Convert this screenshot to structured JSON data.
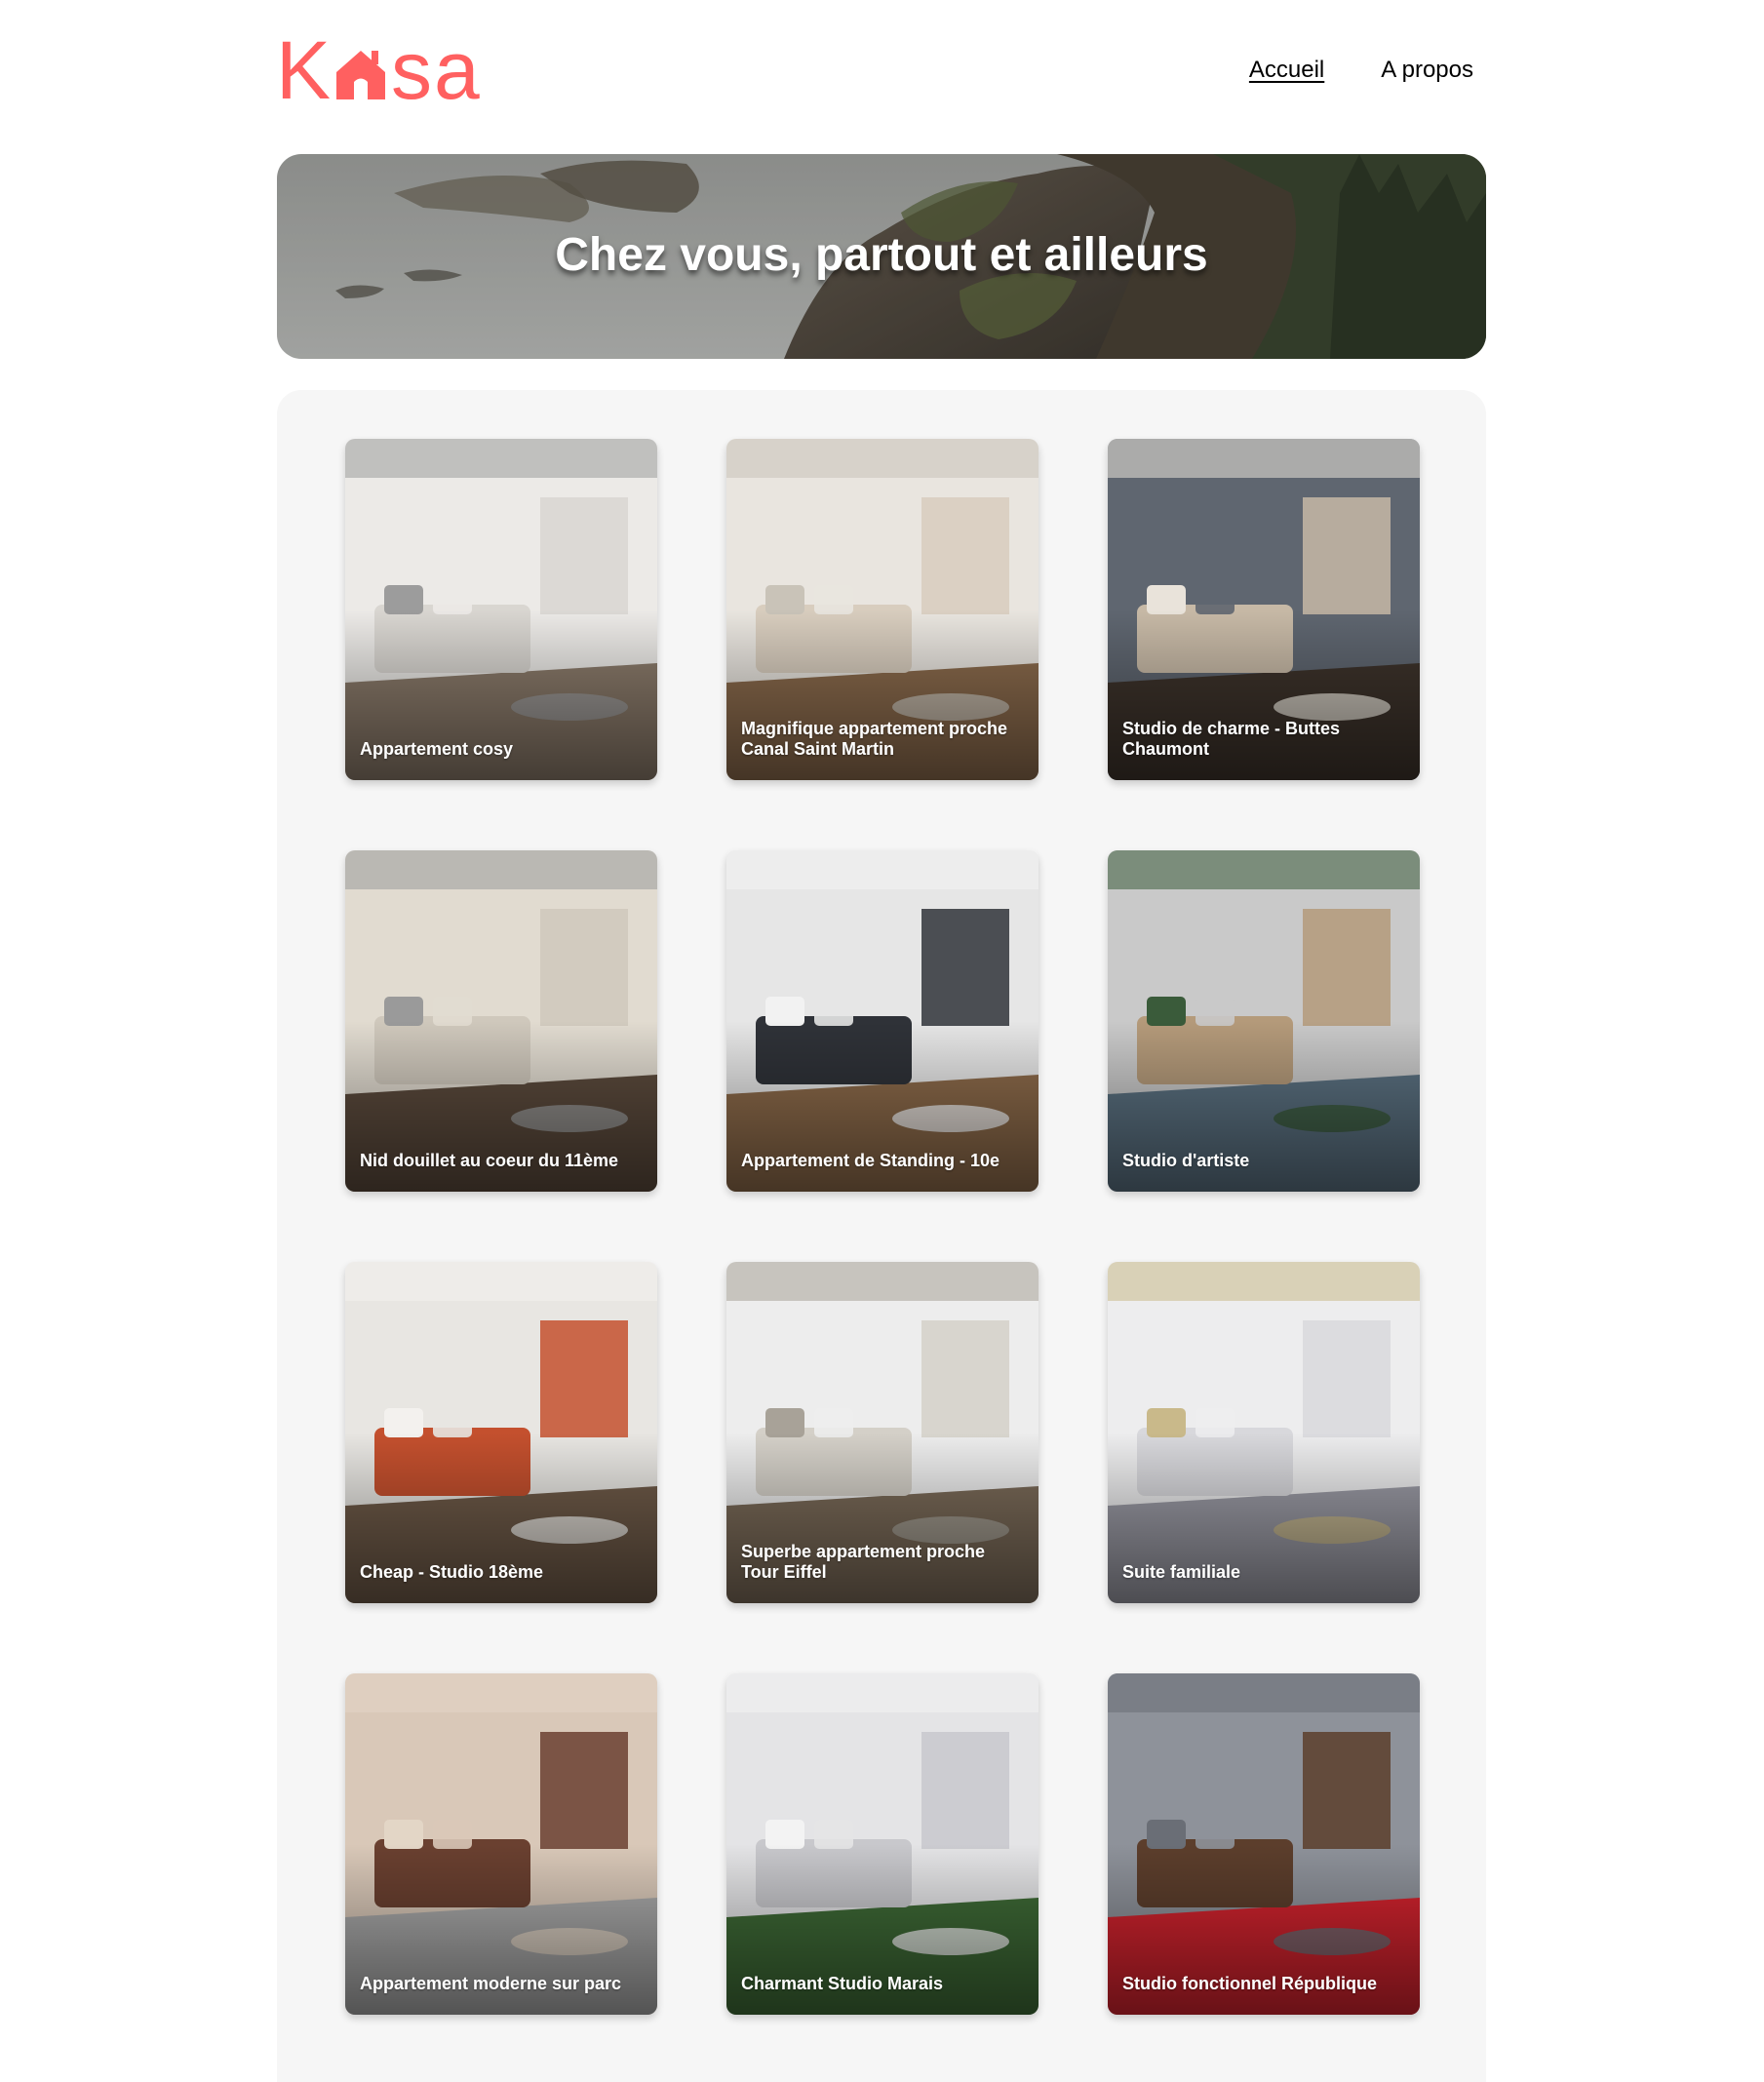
{
  "header": {
    "logo_letters": [
      "K",
      "s",
      "a"
    ],
    "nav": {
      "home_label": "Accueil",
      "about_label": "A propos"
    }
  },
  "banner": {
    "title": "Chez vous, partout et ailleurs"
  },
  "colors": {
    "brand": "#FF6060",
    "gallery_bg": "#F6F6F6"
  },
  "listings": [
    {
      "title": "Appartement cosy",
      "palette": [
        "#ECEAE7",
        "#D9D6D1",
        "#8A7A6A",
        "#9C9C9C"
      ]
    },
    {
      "title": "Magnifique appartement proche Canal Saint Martin",
      "palette": [
        "#E9E5DF",
        "#D8CDBE",
        "#8A6A4C",
        "#C9C3B8"
      ]
    },
    {
      "title": "Studio de charme - Buttes Chaumont",
      "palette": [
        "#5F6670",
        "#C7B9A6",
        "#3D332B",
        "#E9E3DA"
      ]
    },
    {
      "title": "Nid douillet au coeur du 11ème",
      "palette": [
        "#E1DBD0",
        "#CFC8BC",
        "#5B4A3C",
        "#9A9A9A"
      ]
    },
    {
      "title": "Appartement de Standing - 10e",
      "palette": [
        "#E6E6E6",
        "#2F3238",
        "#8C6A4A",
        "#F2F2F2"
      ]
    },
    {
      "title": "Studio d'artiste",
      "palette": [
        "#C9C9C9",
        "#B49A7A",
        "#5A7080",
        "#3A5B3A"
      ]
    },
    {
      "title": "Cheap - Studio 18ème",
      "palette": [
        "#E8E6E2",
        "#C4502E",
        "#6E5A48",
        "#F3F1EE"
      ]
    },
    {
      "title": "Superbe appartement proche Tour Eiffel",
      "palette": [
        "#EDEDED",
        "#D4D0C8",
        "#7A6A58",
        "#A8A298"
      ]
    },
    {
      "title": "Suite familiale",
      "palette": [
        "#EDEDEE",
        "#D8D8DC",
        "#9A9AA4",
        "#C9B98A"
      ]
    },
    {
      "title": "Appartement moderne sur parc",
      "palette": [
        "#D9C8B8",
        "#6A4030",
        "#A8A8A8",
        "#E3D6C6"
      ]
    },
    {
      "title": "Charmant Studio Marais",
      "palette": [
        "#E4E4E6",
        "#C8C8CC",
        "#3E6A36",
        "#F3F3F3"
      ]
    },
    {
      "title": "Studio fonctionnel République",
      "palette": [
        "#8E929A",
        "#5C3E2C",
        "#D2232E",
        "#6A6E76"
      ]
    }
  ]
}
